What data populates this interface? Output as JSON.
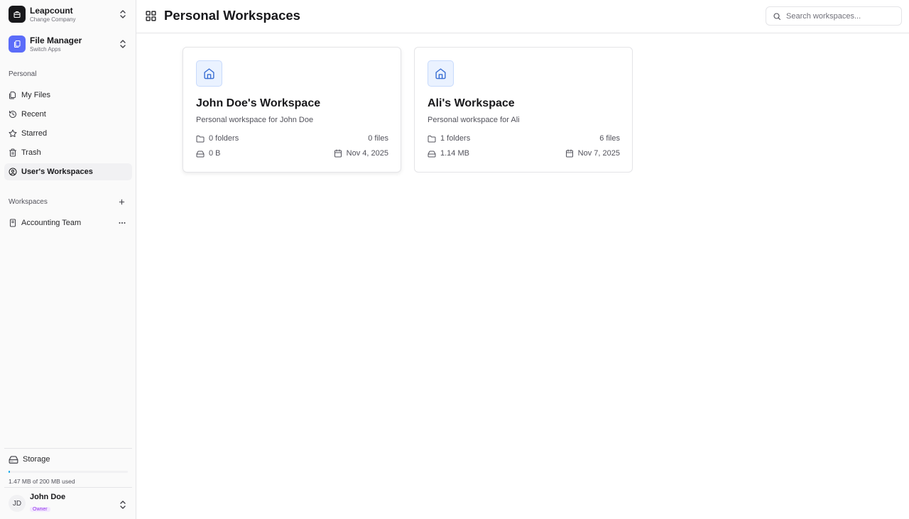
{
  "company": {
    "name": "Leapcount",
    "subtitle": "Change Company"
  },
  "app": {
    "name": "File Manager",
    "subtitle": "Switch Apps"
  },
  "personal": {
    "label": "Personal",
    "items": [
      {
        "label": "My Files",
        "icon": "files-icon"
      },
      {
        "label": "Recent",
        "icon": "clock-icon"
      },
      {
        "label": "Starred",
        "icon": "star-icon"
      },
      {
        "label": "Trash",
        "icon": "trash-icon"
      },
      {
        "label": "User's Workspaces",
        "icon": "user-circle-icon",
        "active": true
      }
    ]
  },
  "workspaces": {
    "label": "Workspaces",
    "items": [
      {
        "label": "Accounting Team",
        "icon": "book-icon"
      }
    ]
  },
  "storage": {
    "label": "Storage",
    "text": "1.47 MB of 200 MB used",
    "used_fraction": 0.0074
  },
  "user": {
    "initials": "JD",
    "name": "John Doe",
    "role": "Owner"
  },
  "header": {
    "title": "Personal Workspaces",
    "icon": "grid-icon"
  },
  "search": {
    "placeholder": "Search workspaces..."
  },
  "cards": [
    {
      "title": "John Doe's Workspace",
      "description": "Personal workspace for John Doe",
      "folders": "0 folders",
      "files": "0 files",
      "size": "0 B",
      "date": "Nov 4, 2025"
    },
    {
      "title": "Ali's Workspace",
      "description": "Personal workspace for Ali",
      "folders": "1 folders",
      "files": "6 files",
      "size": "1.14 MB",
      "date": "Nov 7, 2025"
    }
  ],
  "colors": {
    "accent_blue": "#5b6cf9",
    "icon_blue": "#3b6fd4",
    "storage_fill": "#0ea5e9",
    "owner_badge": "#9333ea"
  }
}
